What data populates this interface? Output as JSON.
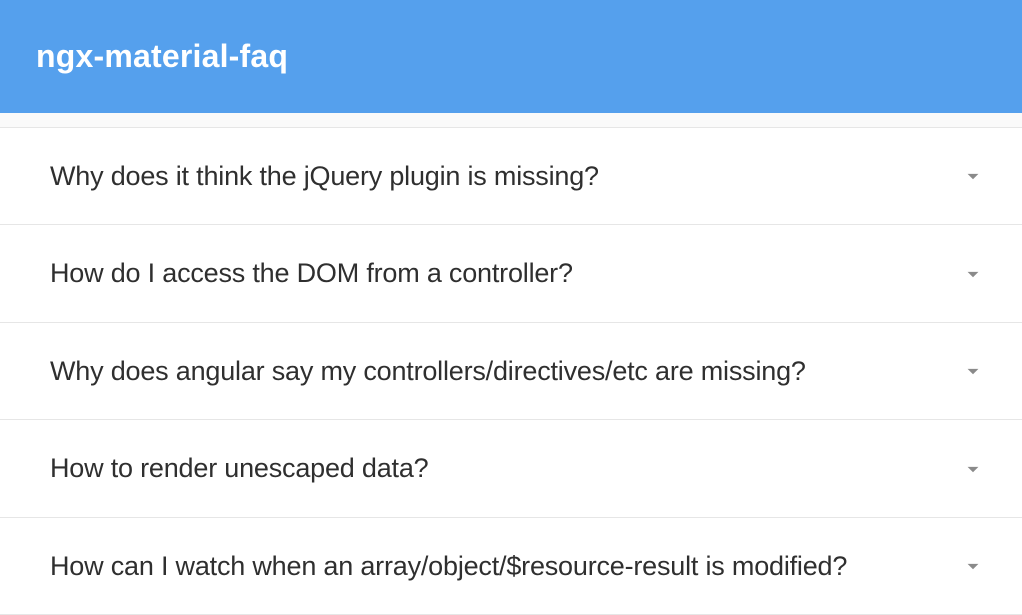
{
  "header": {
    "title": "ngx-material-faq"
  },
  "faq": {
    "items": [
      {
        "question": "Why does it think the jQuery plugin is missing?"
      },
      {
        "question": "How do I access the DOM from a controller?"
      },
      {
        "question": "Why does angular say my controllers/directives/etc are missing?"
      },
      {
        "question": "How to render unescaped data?"
      },
      {
        "question": "How can I watch when an array/object/$resource-result is modified?"
      }
    ]
  }
}
